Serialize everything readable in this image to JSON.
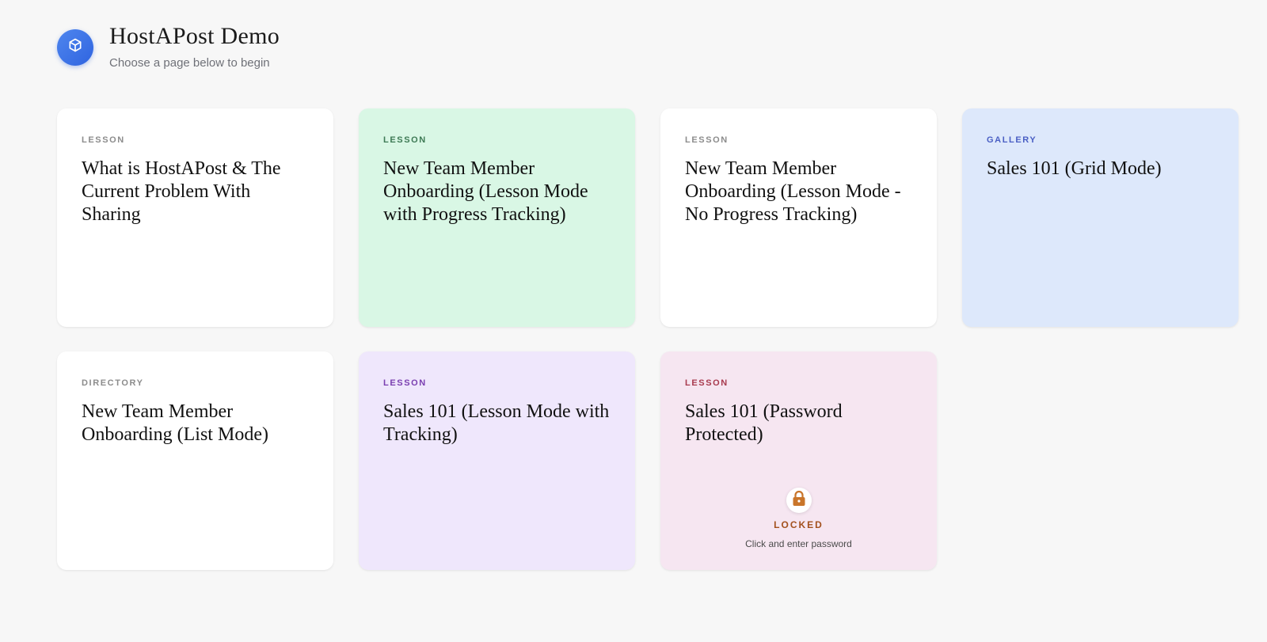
{
  "header": {
    "title": "HostAPost Demo",
    "subtitle": "Choose a page below to begin",
    "logo_icon": "cube-icon",
    "logo_color": "#3b72e6"
  },
  "cards": [
    {
      "type": "LESSON",
      "title": "What is HostAPost & The Current Problem With Sharing",
      "bg": "#ffffff",
      "type_color": "#8c8c8c"
    },
    {
      "type": "LESSON",
      "title": "New Team Member Onboarding (Lesson Mode with Progress Tracking)",
      "bg": "#d9f7e5",
      "type_color": "#3e7a55"
    },
    {
      "type": "LESSON",
      "title": "New Team Member Onboarding (Lesson Mode - No Progress Tracking)",
      "bg": "#ffffff",
      "type_color": "#8c8c8c"
    },
    {
      "type": "GALLERY",
      "title": "Sales 101 (Grid Mode)",
      "bg": "#dde8fb",
      "type_color": "#4a5fc4"
    },
    {
      "type": "DIRECTORY",
      "title": "New Team Member Onboarding (List Mode)",
      "bg": "#ffffff",
      "type_color": "#8c8c8c"
    },
    {
      "type": "LESSON",
      "title": "Sales 101 (Lesson Mode with Tracking)",
      "bg": "#efe7fc",
      "type_color": "#7a3fb0"
    },
    {
      "type": "LESSON",
      "title": "Sales 101 (Password Protected)",
      "bg": "#f6e6f1",
      "type_color": "#a83a4e",
      "locked": {
        "label": "LOCKED",
        "hint": "Click and enter password",
        "icon": "padlock-icon",
        "icon_color": "#c9752a"
      }
    }
  ]
}
